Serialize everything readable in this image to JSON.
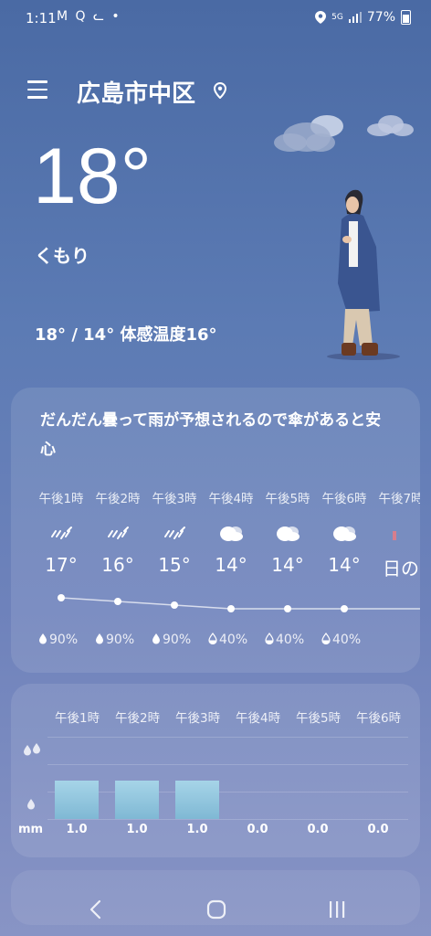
{
  "status_bar": {
    "time": "1:11",
    "left_icons": [
      "gmail-icon",
      "search-icon",
      "cat-icon",
      "dot-icon"
    ],
    "network": "5G",
    "battery": "77%"
  },
  "header": {
    "location": "広島市中区"
  },
  "current": {
    "temperature": "18°",
    "condition": "くもり",
    "range": "18° / 14° 体感温度16°"
  },
  "forecast": {
    "message": "だんだん曇って雨が予想されるので傘があると安心",
    "hours": [
      {
        "time": "午後1時",
        "icon": "rain-icon",
        "temp": "17°",
        "pop": "90%",
        "temp_value": 17
      },
      {
        "time": "午後2時",
        "icon": "rain-icon",
        "temp": "16°",
        "pop": "90%",
        "temp_value": 16
      },
      {
        "time": "午後3時",
        "icon": "rain-icon",
        "temp": "15°",
        "pop": "90%",
        "temp_value": 15
      },
      {
        "time": "午後4時",
        "icon": "cloudy-icon",
        "temp": "14°",
        "pop": "40%",
        "temp_value": 14
      },
      {
        "time": "午後5時",
        "icon": "cloudy-icon",
        "temp": "14°",
        "pop": "40%",
        "temp_value": 14
      },
      {
        "time": "午後6時",
        "icon": "cloudy-icon",
        "temp": "14°",
        "pop": "40%",
        "temp_value": 14
      },
      {
        "time": "午後7時",
        "icon": "sunset-icon",
        "temp": "日の",
        "pop": "",
        "temp_value": null
      }
    ]
  },
  "rain": {
    "unit": "mm",
    "hours": [
      {
        "time": "午後1時",
        "value": "1.0",
        "amount": 1.0
      },
      {
        "time": "午後2時",
        "value": "1.0",
        "amount": 1.0
      },
      {
        "time": "午後3時",
        "value": "1.0",
        "amount": 1.0
      },
      {
        "time": "午後4時",
        "value": "0.0",
        "amount": 0.0
      },
      {
        "time": "午後5時",
        "value": "0.0",
        "amount": 0.0
      },
      {
        "time": "午後6時",
        "value": "0.0",
        "amount": 0.0
      }
    ]
  },
  "colors": {
    "bar_top": "#a6d4e8",
    "bar_bottom": "#7fb8d4"
  },
  "nav": [
    "back-icon",
    "home-icon",
    "recents-icon"
  ]
}
